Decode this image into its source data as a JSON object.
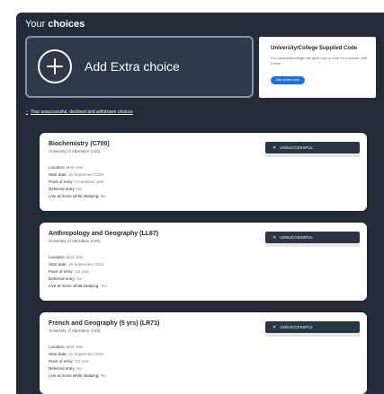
{
  "header": {
    "title_prefix": "Your",
    "title_bold": "choices"
  },
  "add_extra": {
    "label": "Add Extra choice"
  },
  "supplied_code": {
    "title": "University/College Supplied Code",
    "description": "If a university/college has given you a code for a course, add it here",
    "button_label": "Add course code"
  },
  "unsuccessful_link": {
    "label": "Your unsuccessful, declined and withdrawn choices"
  },
  "labels": {
    "location": "Location:",
    "start_date": "Start date:",
    "point_of_entry": "Point of entry:",
    "deferred_entry": "Deferred entry:",
    "live_at_home": "Live at home while studying:"
  },
  "choices": [
    {
      "course": "Biochemistry (C700)",
      "university": "University of Aberdeen (A20)",
      "status": "UNSUCCESSFUL",
      "location": "Main Site",
      "start_date": "15 September 2024",
      "point_of_entry": "Foundation year",
      "deferred_entry": "No",
      "live_at_home": "No"
    },
    {
      "course": "Anthropology and Geography (LL67)",
      "university": "University of Aberdeen (A20)",
      "status": "UNSUCCESSFUL",
      "location": "Main Site",
      "start_date": "15 September 2024",
      "point_of_entry": "1st year",
      "deferred_entry": "No",
      "live_at_home": "Yes"
    },
    {
      "course": "French and Geography (5 yrs) (LR71)",
      "university": "University of Aberdeen (A20)",
      "status": "UNSUCCESSFUL",
      "location": "Main Site",
      "start_date": "15 September 2024",
      "point_of_entry": "1st year",
      "deferred_entry": "No",
      "live_at_home": "No"
    }
  ]
}
